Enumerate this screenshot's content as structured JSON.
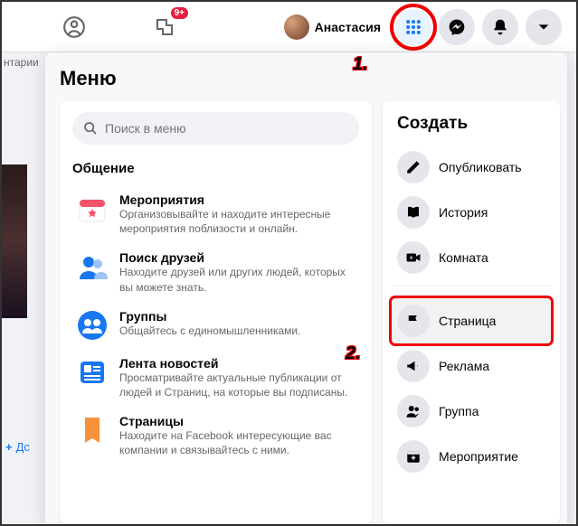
{
  "topbar": {
    "badge_text": "9+",
    "profile_name": "Анастасия"
  },
  "side": {
    "frag_text": "нтарии",
    "link_text": "Дс"
  },
  "menu": {
    "title": "Меню",
    "search_placeholder": "Поиск в меню",
    "section_label": "Общение",
    "items": [
      {
        "title": "Мероприятия",
        "desc": "Организовывайте и находите интересные мероприятия поблизости и онлайн."
      },
      {
        "title": "Поиск друзей",
        "desc": "Находите друзей или других людей, которых вы можете знать."
      },
      {
        "title": "Группы",
        "desc": "Общайтесь с единомышленниками."
      },
      {
        "title": "Лента новостей",
        "desc": "Просматривайте актуальные публикации от людей и Страниц, на которые вы подписаны."
      },
      {
        "title": "Страницы",
        "desc": "Находите на Facebook интересующие вас компании и связывайтесь с ними."
      }
    ]
  },
  "create": {
    "title": "Создать",
    "items": [
      {
        "label": "Опубликовать"
      },
      {
        "label": "История"
      },
      {
        "label": "Комната"
      },
      {
        "label": "Страница"
      },
      {
        "label": "Реклама"
      },
      {
        "label": "Группа"
      },
      {
        "label": "Мероприятие"
      }
    ]
  },
  "annotations": {
    "a1": "1.",
    "a2": "2."
  }
}
